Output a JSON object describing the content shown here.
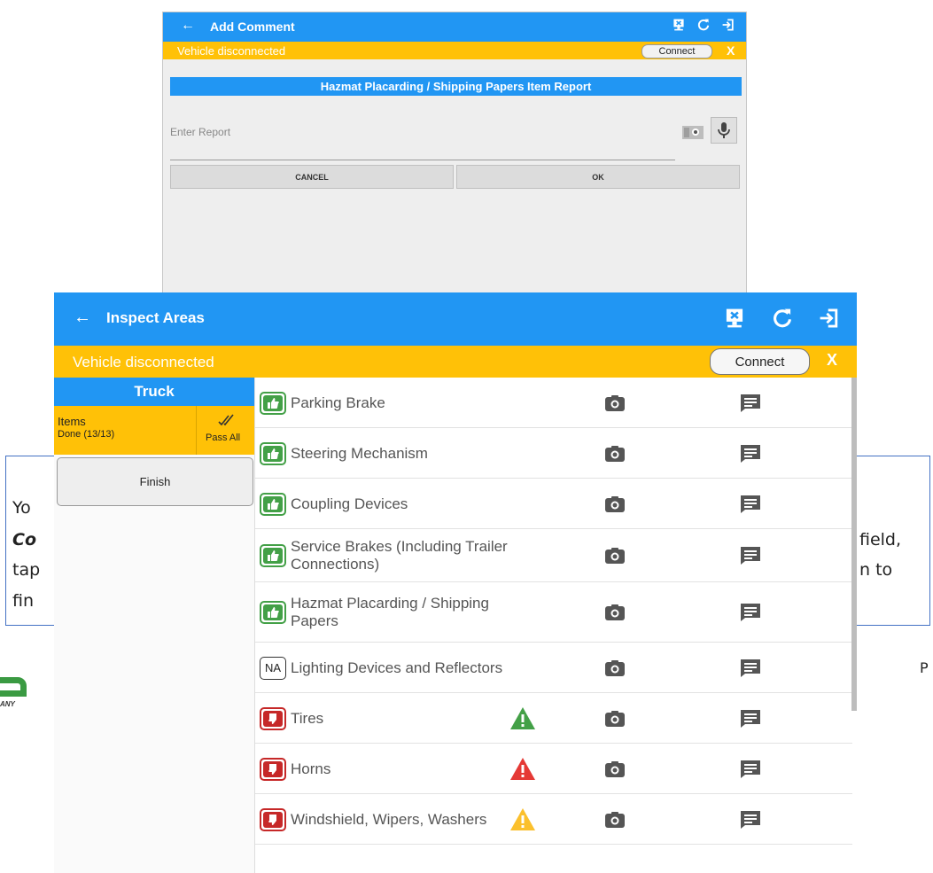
{
  "document": {
    "para_line1": "Yo",
    "para_line2": "Co",
    "para_line3": "tap",
    "para_line4": "fin",
    "para_right1": "field,",
    "para_right2": "n to",
    "page_label": "P",
    "logo_mark": "®",
    "logo_tagline": "ANY"
  },
  "add_comment": {
    "back_icon": "arrow-left-icon",
    "title": "Add Comment",
    "banner_text": "Vehicle disconnected",
    "connect_label": "Connect",
    "close_label": "X",
    "report_header": "Hazmat Placarding / Shipping Papers Item Report",
    "report_placeholder": "Enter Report",
    "cancel_label": "CANCEL",
    "ok_label": "OK"
  },
  "inspect": {
    "back_icon": "arrow-left-icon",
    "title": "Inspect Areas",
    "banner_text": "Vehicle disconnected",
    "connect_label": "Connect",
    "close_label": "X",
    "sidebar": {
      "header": "Truck",
      "items_label": "Items",
      "items_done": "Done (13/13)",
      "pass_all": "Pass All",
      "finish": "Finish"
    },
    "items": [
      {
        "label": "Parking Brake",
        "status": "pass",
        "warning": null
      },
      {
        "label": "Steering Mechanism",
        "status": "pass",
        "warning": null
      },
      {
        "label": "Coupling Devices",
        "status": "pass",
        "warning": null
      },
      {
        "label": "Service Brakes (Including Trailer Connections)",
        "status": "pass",
        "warning": null
      },
      {
        "label": "Hazmat Placarding / Shipping Papers",
        "status": "pass",
        "warning": null
      },
      {
        "label": "Lighting Devices and Reflectors",
        "status": "na",
        "na_text": "NA",
        "warning": null
      },
      {
        "label": "Tires",
        "status": "fail",
        "warning": "green"
      },
      {
        "label": "Horns",
        "status": "fail",
        "warning": "red"
      },
      {
        "label": "Windshield, Wipers, Washers",
        "status": "fail",
        "warning": "yellow"
      }
    ]
  },
  "colors": {
    "primary": "#2196f3",
    "banner": "#ffc107",
    "pass": "#43a047",
    "fail": "#c62828",
    "warn_green": "#43a047",
    "warn_red": "#e53935",
    "warn_yellow": "#fbc02d",
    "icon_gray": "#555555"
  }
}
